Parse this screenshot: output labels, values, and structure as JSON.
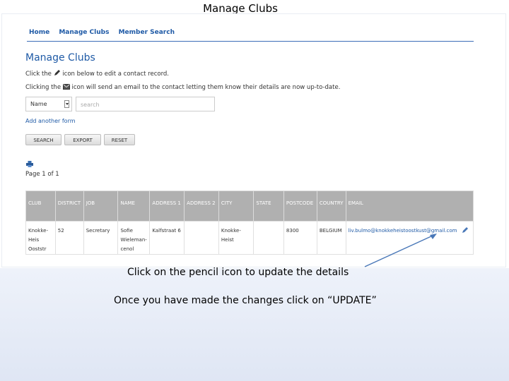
{
  "slide": {
    "title": "Manage Clubs",
    "callout_pencil": "Click on the pencil icon to update the details",
    "callout_update": "Once you have made the changes click on “UPDATE”"
  },
  "nav": {
    "items": [
      "Home",
      "Manage Clubs",
      "Member Search"
    ]
  },
  "page": {
    "heading": "Manage Clubs",
    "instr1_pre": "Click the",
    "instr1_post": "icon below to edit a contact record.",
    "instr2_pre": "Clicking the",
    "instr2_post": "icon will send an email to the contact letting them know their details are now up-to-date."
  },
  "filter": {
    "field_selected": "Name",
    "search_placeholder": "search",
    "add_form_label": "Add another form"
  },
  "buttons": {
    "search": "SEARCH",
    "export": "EXPORT",
    "reset": "RESET"
  },
  "pagination": {
    "label": "Page 1 of 1"
  },
  "table": {
    "columns": [
      "CLUB",
      "DISTRICT",
      "JOB",
      "NAME",
      "ADDRESS 1",
      "ADDRESS 2",
      "CITY",
      "STATE",
      "POSTCODE",
      "COUNTRY",
      "EMAIL"
    ],
    "rows": [
      {
        "club": "Knokke-Heis Ooststr",
        "district": "52",
        "job": "Secretary",
        "name": "Sofie Wieleman-cenol",
        "address1": "Kalfstraat 6",
        "address2": "",
        "city": "Knokke-Heist",
        "state": "",
        "postcode": "8300",
        "country": "BELGIUM",
        "email": "liv.bulmo@knokkeheistoostkust@gmail.com"
      }
    ]
  },
  "icons": {
    "pencil": "pencil-icon",
    "mail": "mail-icon",
    "print": "print-icon",
    "dropdown": "chevron-down-icon"
  },
  "colors": {
    "link": "#1f5aa6",
    "header_bg": "#b0b0b0",
    "arrow": "#4a78b8"
  }
}
